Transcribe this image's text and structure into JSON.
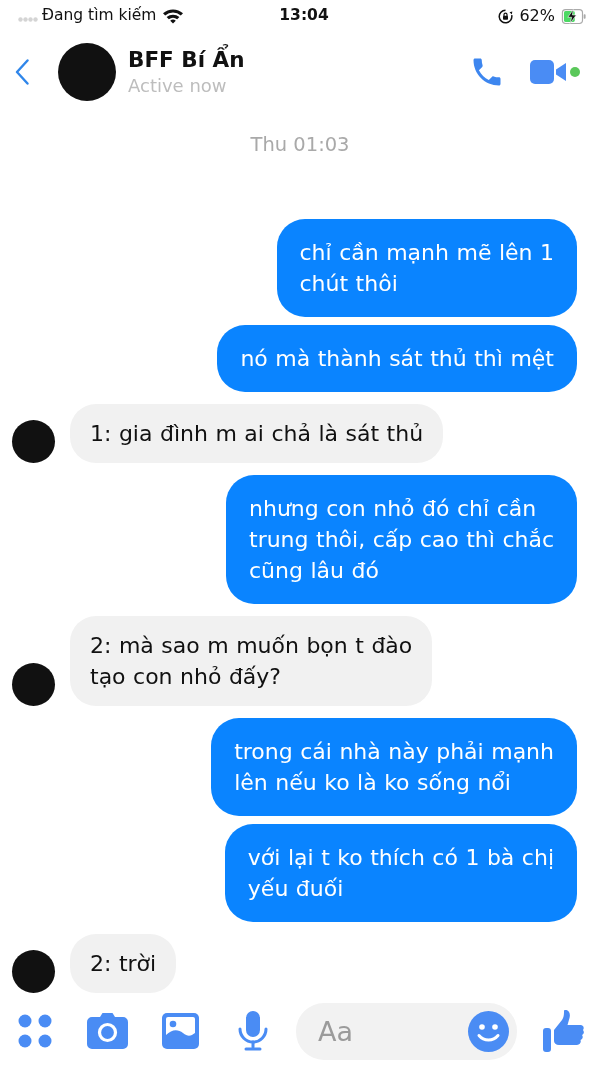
{
  "status_bar": {
    "carrier": "Đang tìm kiếm",
    "time": "13:04",
    "battery": "62%",
    "charging": true
  },
  "header": {
    "title": "BFF Bí Ẩn",
    "subtitle": "Active now"
  },
  "timestamp": "Thu 01:03",
  "messages": [
    {
      "kind": "sent",
      "text": "chỉ cần mạnh mẽ lên 1\nchút thôi"
    },
    {
      "kind": "sent",
      "text": "nó mà thành sát thủ thì mệt"
    },
    {
      "kind": "received",
      "text": "1: gia đình m ai chả là sát thủ"
    },
    {
      "kind": "sent",
      "text": "nhưng con nhỏ đó chỉ cần\ntrung thôi, cấp cao thì chắc\ncũng lâu đó"
    },
    {
      "kind": "received",
      "text": "2: mà sao m muốn bọn t đào\ntạo con nhỏ đấy?"
    },
    {
      "kind": "sent",
      "text": "trong cái nhà này phải mạnh\nlên nếu ko là ko sống nổi"
    },
    {
      "kind": "sent",
      "text": "với lại t ko thích có 1 bà chị\nyếu đuối"
    },
    {
      "kind": "received",
      "text": "2: trời"
    }
  ],
  "composer": {
    "placeholder": "Aa"
  }
}
